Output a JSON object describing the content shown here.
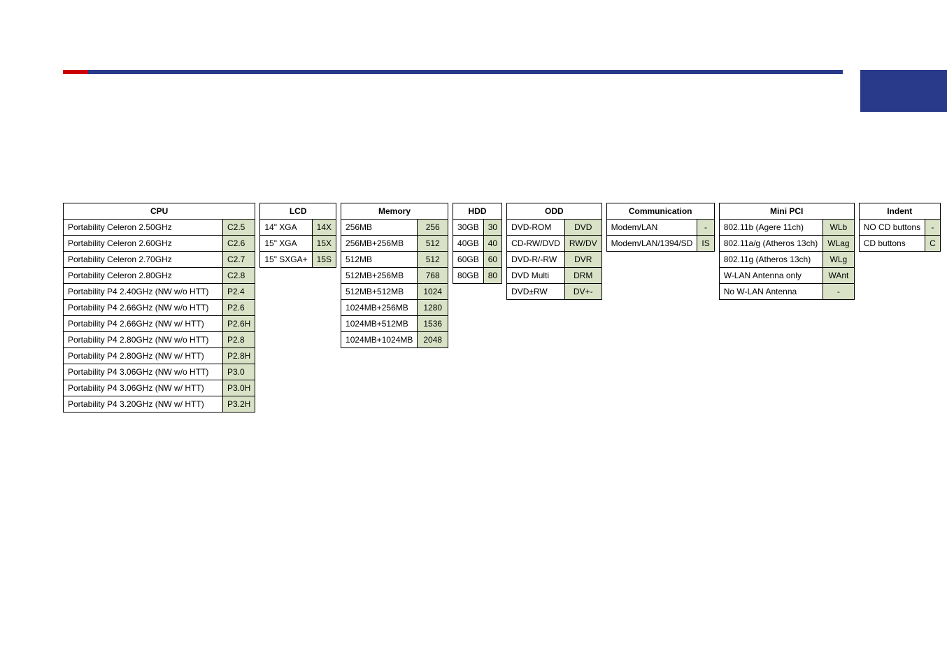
{
  "headers": {
    "cpu": "CPU",
    "lcd": "LCD",
    "memory": "Memory",
    "hdd": "HDD",
    "odd": "ODD",
    "communication": "Communication",
    "minipci": "Mini PCI",
    "indent": "Indent"
  },
  "cpu": [
    {
      "desc": "Portability Celeron 2.50GHz",
      "code": "C2.5"
    },
    {
      "desc": "Portability Celeron 2.60GHz",
      "code": "C2.6"
    },
    {
      "desc": "Portability Celeron 2.70GHz",
      "code": "C2.7"
    },
    {
      "desc": "Portability Celeron 2.80GHz",
      "code": "C2.8"
    },
    {
      "desc": "Portability P4 2.40GHz (NW w/o HTT)",
      "code": "P2.4"
    },
    {
      "desc": "Portability P4 2.66GHz (NW w/o HTT)",
      "code": "P2.6"
    },
    {
      "desc": "Portability P4 2.66GHz (NW w/ HTT)",
      "code": "P2.6H"
    },
    {
      "desc": "Portability P4 2.80GHz (NW w/o HTT)",
      "code": "P2.8"
    },
    {
      "desc": "Portability P4 2.80GHz (NW w/ HTT)",
      "code": "P2.8H"
    },
    {
      "desc": "Portability P4 3.06GHz (NW w/o HTT)",
      "code": "P3.0"
    },
    {
      "desc": "Portability P4 3.06GHz (NW w/ HTT)",
      "code": "P3.0H"
    },
    {
      "desc": "Portability P4 3.20GHz (NW w/ HTT)",
      "code": "P3.2H"
    }
  ],
  "lcd": [
    {
      "desc": "14\" XGA",
      "code": "14X"
    },
    {
      "desc": "15\" XGA",
      "code": "15X"
    },
    {
      "desc": "15\" SXGA+",
      "code": "15S"
    }
  ],
  "memory": [
    {
      "desc": "256MB",
      "code": "256"
    },
    {
      "desc": "256MB+256MB",
      "code": "512"
    },
    {
      "desc": "512MB",
      "code": "512"
    },
    {
      "desc": "512MB+256MB",
      "code": "768"
    },
    {
      "desc": "512MB+512MB",
      "code": "1024"
    },
    {
      "desc": "1024MB+256MB",
      "code": "1280"
    },
    {
      "desc": "1024MB+512MB",
      "code": "1536"
    },
    {
      "desc": "1024MB+1024MB",
      "code": "2048"
    }
  ],
  "hdd": [
    {
      "desc": "30GB",
      "code": "30"
    },
    {
      "desc": "40GB",
      "code": "40"
    },
    {
      "desc": "60GB",
      "code": "60"
    },
    {
      "desc": "80GB",
      "code": "80"
    }
  ],
  "odd": [
    {
      "desc": "DVD-ROM",
      "code": "DVD"
    },
    {
      "desc": "CD-RW/DVD",
      "code": "RW/DV"
    },
    {
      "desc": "DVD-R/-RW",
      "code": "DVR"
    },
    {
      "desc": "DVD Multi",
      "code": "DRM"
    },
    {
      "desc": "DVD±RW",
      "code": "DV+-"
    }
  ],
  "communication": [
    {
      "desc": "Modem/LAN",
      "code": "-"
    },
    {
      "desc": "Modem/LAN/1394/SD",
      "code": "IS"
    }
  ],
  "minipci": [
    {
      "desc": "802.11b (Agere 11ch)",
      "code": "WLb"
    },
    {
      "desc": "802.11a/g (Atheros 13ch)",
      "code": "WLag"
    },
    {
      "desc": "802.11g (Atheros 13ch)",
      "code": "WLg"
    },
    {
      "desc": "W-LAN Antenna only",
      "code": "WAnt"
    },
    {
      "desc": "No W-LAN Antenna",
      "code": "-"
    }
  ],
  "indent": [
    {
      "desc": "NO CD buttons",
      "code": "-"
    },
    {
      "desc": "CD buttons",
      "code": "C"
    }
  ]
}
